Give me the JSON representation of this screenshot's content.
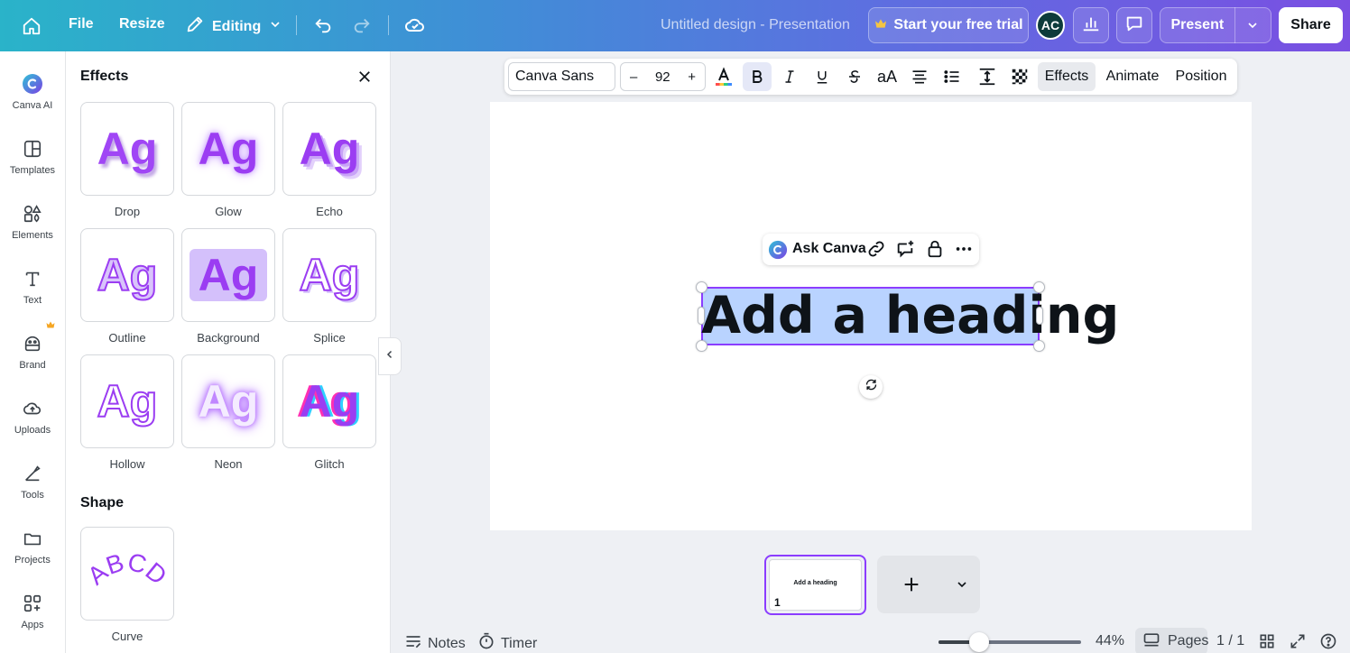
{
  "topbar": {
    "file_label": "File",
    "resize_label": "Resize",
    "editing_label": "Editing",
    "document_title": "Untitled design - Presentation",
    "trial_label": "Start your free trial",
    "avatar_initials": "AC",
    "present_label": "Present",
    "share_label": "Share"
  },
  "rail": {
    "items": [
      {
        "label": "Canva AI",
        "icon": "canva-ai-icon"
      },
      {
        "label": "Templates",
        "icon": "templates-icon"
      },
      {
        "label": "Elements",
        "icon": "elements-icon"
      },
      {
        "label": "Text",
        "icon": "text-icon"
      },
      {
        "label": "Brand",
        "icon": "brand-icon"
      },
      {
        "label": "Uploads",
        "icon": "uploads-icon"
      },
      {
        "label": "Tools",
        "icon": "tools-icon"
      },
      {
        "label": "Projects",
        "icon": "projects-icon"
      },
      {
        "label": "Apps",
        "icon": "apps-icon"
      }
    ]
  },
  "panel": {
    "title": "Effects",
    "sample_text": "Ag",
    "effects": [
      {
        "label": "Drop"
      },
      {
        "label": "Glow"
      },
      {
        "label": "Echo"
      },
      {
        "label": "Outline"
      },
      {
        "label": "Background"
      },
      {
        "label": "Splice"
      },
      {
        "label": "Hollow"
      },
      {
        "label": "Neon"
      },
      {
        "label": "Glitch"
      }
    ],
    "shape_title": "Shape",
    "shape_sample": "ABCD",
    "shape_label": "Curve"
  },
  "toolbar": {
    "font_name": "Canva Sans",
    "font_size": "92",
    "minus": "–",
    "plus": "+",
    "effects_label": "Effects",
    "animate_label": "Animate",
    "position_label": "Position"
  },
  "canvas": {
    "ask_label": "Ask Canva",
    "heading": "Add a heading"
  },
  "pages": {
    "thumb_heading": "Add a heading",
    "thumb_number": "1"
  },
  "bottombar": {
    "notes_label": "Notes",
    "timer_label": "Timer",
    "zoom_value": 0.44,
    "zoom_label": "44%",
    "pages_label": "Pages",
    "page_count": "1 / 1"
  },
  "colors": {
    "accent": "#8b3dff",
    "effect_purple": "#a046f5",
    "selection_fill": "#b9d3ff"
  }
}
